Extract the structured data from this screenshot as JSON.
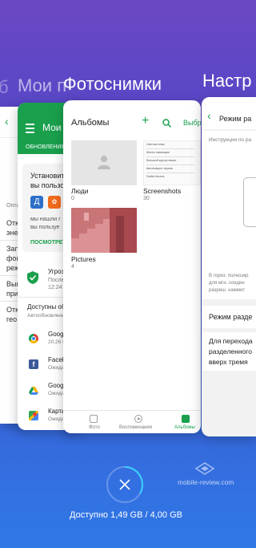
{
  "app_titles": {
    "far": "б",
    "play_store": "Мои п",
    "photos": "Фотоснимки",
    "settings": "Настр"
  },
  "far_card": {
    "tab_label": "Опти",
    "rows": [
      "Отк",
      "эне",
      "Зап",
      "фон",
      "реж",
      "Вык",
      "при",
      "Отк",
      "гео"
    ]
  },
  "play_store": {
    "header_title": "Мои п",
    "tab": "ОБНОВЛЕНИЯ",
    "promo_title_1": "Установит",
    "promo_title_2": "вы пользо",
    "promo_desc_1": "мы нашли г",
    "promo_desc_2": "вы пользуе",
    "promo_link": "ПОСМОТРЕТ",
    "threat_title": "Угроз",
    "threat_line_1": "Послед",
    "threat_line_2": "12:24",
    "updates_title": "Доступны обн",
    "updates_sub": "Автообновление",
    "apps": [
      {
        "name": "Google",
        "status": "20,26 М"
      },
      {
        "name": "Facebo",
        "status": "Ожида"
      },
      {
        "name": "Google",
        "status": "Ожида"
      },
      {
        "name": "Карты",
        "status": "Ожида"
      }
    ]
  },
  "photos": {
    "header_title": "Альбомы",
    "header_action": "Выбра",
    "albums": [
      {
        "name": "Люди",
        "count": "0"
      },
      {
        "name": "Screenshots",
        "count": "30"
      },
      {
        "name": "Pictures",
        "count": "4"
      }
    ],
    "nav": [
      {
        "label": "Фото",
        "active": false
      },
      {
        "label": "Воспоминания",
        "active": false
      },
      {
        "label": "Альбомы",
        "active": true
      }
    ],
    "screenshot_lines": [
      "Светлая тема",
      "Жесты навигации",
      "Большой курсор мыши",
      "Автоповорот экрана",
      "Switch Access"
    ]
  },
  "settings": {
    "header_title": "Режим ра",
    "instruction": "Инструкции по ра",
    "landscape_text": [
      "В гориз. полноэкр",
      "для мгн. соедин",
      "разреш. нажмит"
    ],
    "split_mode": "Режим разде",
    "split_desc": [
      "Для перехода",
      "разделенного",
      "вверх тремя"
    ]
  },
  "close_button_icon": "close-icon",
  "memory": "Доступно 1,49 GB / 4,00 GB",
  "watermark": "mobile-review.com",
  "colors": {
    "accent_green": "#1aa04d",
    "bg_top": "#6b47c4",
    "bg_bottom": "#2f78e6"
  }
}
